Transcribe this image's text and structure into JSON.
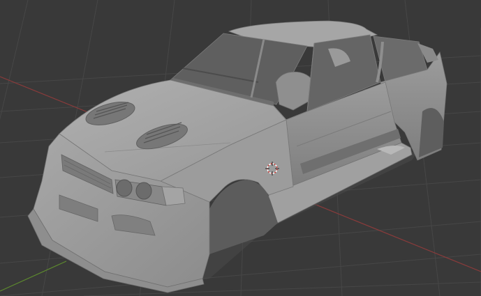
{
  "viewport": {
    "type": "3d-viewport",
    "background": "#393939",
    "grid_color": "#454545",
    "x_axis_color": "#8a3b3b",
    "y_axis_color": "#5d8a2e"
  },
  "scene": {
    "object_icon": "car-body-mesh",
    "origin_icon": "3d-cursor-icon",
    "mesh_color": "#9a9a9a",
    "shadow_color": "#5a5a5a"
  }
}
